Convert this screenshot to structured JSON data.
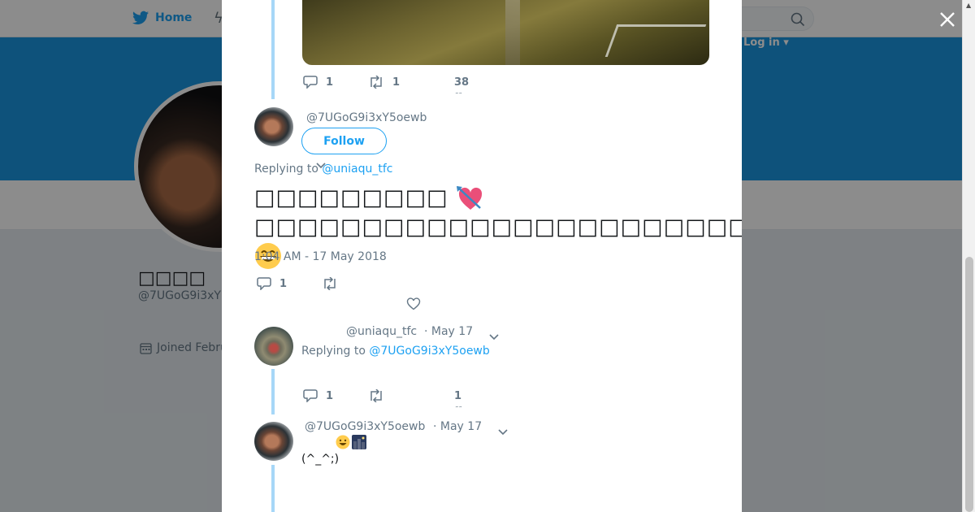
{
  "nav": {
    "home_label": "Home",
    "login_label": "Log in ▾"
  },
  "profile": {
    "name": "□□□□",
    "handle": "@7UGoG9i3xY",
    "joined": "Joined Febru"
  },
  "modal": {
    "prev_tweet_actions": {
      "replies": "1",
      "retweets": "1",
      "likes": "38",
      "likes_sub": "˜˜"
    },
    "main_tweet": {
      "handle": "@7UGoG9i3xY5oewb",
      "follow_label": "Follow",
      "replying_prefix": "Replying to",
      "replying_to": "@uniaqu_tfc",
      "line1": "□□□□□□□□□",
      "line2": "□□□□□□□□□□□□□□□□□□□□□□□□□□□",
      "timestamp": "1:04 AM - 17 May 2018",
      "replies": "1"
    },
    "reply1": {
      "handle": "@uniaqu_tfc",
      "date": "· May 17",
      "replying_prefix": "Replying to",
      "replying_to": "@7UGoG9i3xY5oewb",
      "replies": "1",
      "likes": "1",
      "likes_sub": "˜˜"
    },
    "reply2": {
      "handle": "@7UGoG9i3xY5oewb",
      "date": "· May 17",
      "text": "(^_^;)"
    }
  },
  "colors": {
    "accent": "#1da1f2",
    "banner": "#1b95e0",
    "thread": "#a6d7f7",
    "muted": "#657786"
  }
}
